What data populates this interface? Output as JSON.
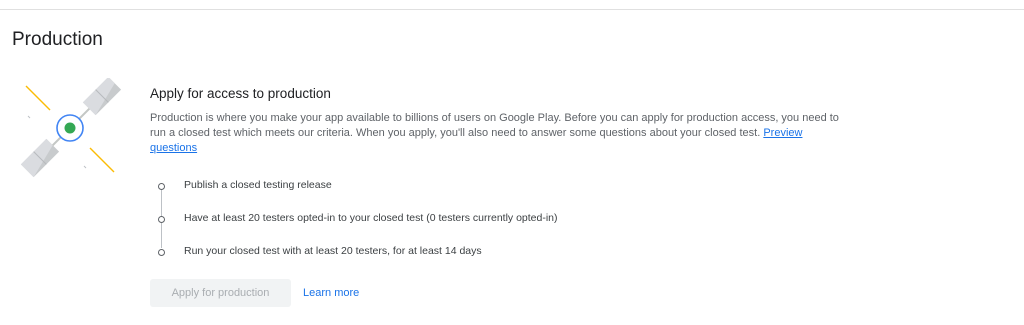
{
  "page": {
    "title": "Production"
  },
  "card": {
    "title": "Apply for access to production",
    "description": "Production is where you make your app available to billions of users on Google Play. Before you can apply for production access, you need to run a closed test which meets our criteria. When you apply, you'll also need to answer some questions about your closed test. ",
    "description_link": "Preview questions",
    "illustration_icon": "satellite-icon"
  },
  "steps": [
    {
      "label": "Publish a closed testing release"
    },
    {
      "label": "Have at least 20 testers opted-in to your closed test (0 testers currently opted-in)"
    },
    {
      "label": "Run your closed test with at least 20 testers, for at least 14 days"
    }
  ],
  "actions": {
    "apply_label": "Apply for production",
    "apply_disabled": true,
    "learn_more_label": "Learn more"
  },
  "colors": {
    "link": "#1a73e8",
    "disabled_button_bg": "#f1f3f4",
    "disabled_button_text": "#a9adb1",
    "satellite_dot": "#34a853",
    "satellite_ring": "#4285f4",
    "light_rays": "#fbbc04"
  }
}
